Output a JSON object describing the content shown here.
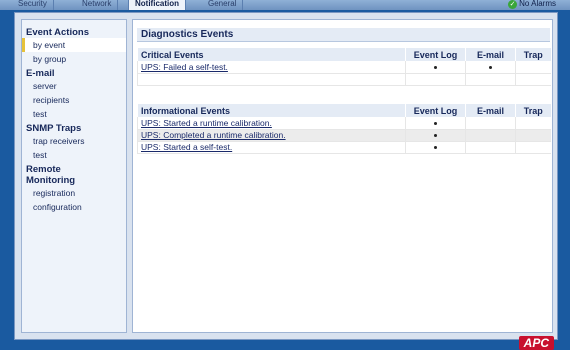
{
  "tabs": [
    {
      "label": "Security"
    },
    {
      "label": "Network"
    },
    {
      "label": "Notification",
      "active": true
    },
    {
      "label": "General"
    }
  ],
  "alarm_status": "No Alarms",
  "sidebar": {
    "sections": [
      {
        "title": "Event Actions",
        "items": [
          {
            "label": "by event",
            "active": true
          },
          {
            "label": "by group"
          }
        ]
      },
      {
        "title": "E-mail",
        "items": [
          {
            "label": "server"
          },
          {
            "label": "recipients"
          },
          {
            "label": "test"
          }
        ]
      },
      {
        "title": "SNMP Traps",
        "items": [
          {
            "label": "trap receivers"
          },
          {
            "label": "test"
          }
        ]
      },
      {
        "title": "Remote Monitoring",
        "title_lines": [
          "Remote",
          "Monitoring"
        ],
        "items": [
          {
            "label": "registration"
          },
          {
            "label": "configuration"
          }
        ]
      }
    ]
  },
  "main": {
    "title": "Diagnostics Events",
    "columns": [
      "Event Log",
      "E-mail",
      "Trap"
    ],
    "critical": {
      "header": "Critical Events",
      "rows": [
        {
          "label": "UPS: Failed a self-test.",
          "event_log": true,
          "email": true,
          "trap": false
        }
      ]
    },
    "informational": {
      "header": "Informational Events",
      "rows": [
        {
          "label": "UPS: Started a runtime calibration.",
          "event_log": true,
          "email": false,
          "trap": false
        },
        {
          "label": "UPS: Completed a runtime calibration.",
          "event_log": true,
          "email": false,
          "trap": false
        },
        {
          "label": "UPS: Started a self-test.",
          "event_log": true,
          "email": false,
          "trap": false
        }
      ]
    }
  },
  "brand": "APC",
  "colors": {
    "brand": "#c8102e",
    "ok": "#3aa63a",
    "accent": "#e6c23a"
  }
}
